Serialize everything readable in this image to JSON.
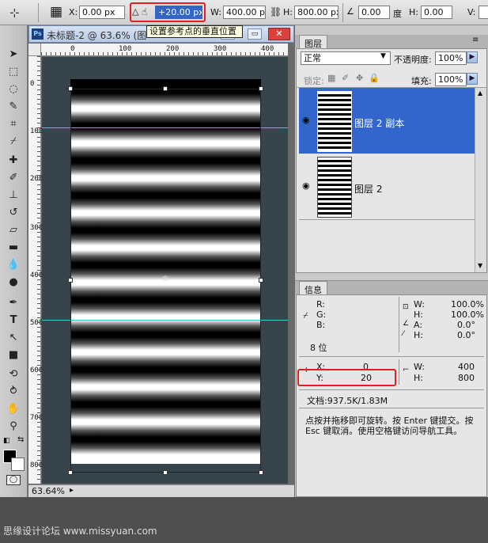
{
  "options": {
    "x_label": "X:",
    "x_value": "0.00 px",
    "y_value": "+20.00 px",
    "w_label": "W:",
    "w_value": "400.00 px",
    "h_label": "H:",
    "h_value": "800.00 px",
    "angle_value": "0.00",
    "angle_unit": "度",
    "hskew_label": "H:",
    "hskew_value": "0.00",
    "vskew_label": "V:",
    "tooltip": "设置参考点的垂直位置"
  },
  "document": {
    "title": "未标题-2 @ 63.6% (图",
    "zoom": "63.64%",
    "ruler_h": [
      "0",
      "100",
      "200",
      "300",
      "400"
    ],
    "ruler_v": [
      "0",
      "100",
      "200",
      "300",
      "400",
      "500",
      "600",
      "700",
      "800"
    ]
  },
  "layers": {
    "tab": "图层",
    "blend_mode": "正常",
    "opacity_label": "不透明度:",
    "opacity_value": "100%",
    "lock_label": "锁定:",
    "fill_label": "填充:",
    "fill_value": "100%",
    "items": [
      {
        "name": "图层 2 副本",
        "selected": true
      },
      {
        "name": "图层 2",
        "selected": false
      }
    ]
  },
  "info": {
    "tab": "信息",
    "r_label": "R:",
    "g_label": "G:",
    "b_label": "B:",
    "bit_depth": "8 位",
    "w1_label": "W:",
    "w1_value": "100.0%",
    "h1_label": "H:",
    "h1_value": "100.0%",
    "a_label": "A:",
    "a_value": "0.0°",
    "h2_label": "H:",
    "h2_value": "0.0°",
    "x_label": "X:",
    "x_value": "0",
    "y_label": "Y:",
    "y_value": "20",
    "w2_label": "W:",
    "w2_value": "400",
    "h3_label": "H:",
    "h3_value": "800",
    "doc_label": "文档:937.5K/1.83M",
    "hint": "点按并拖移即可旋转。按 Enter 键提交。按 Esc 键取消。使用空格键访问导航工具。"
  },
  "watermark": "思缘设计论坛  www.missyuan.com",
  "colors": {
    "accent": "#3366cc",
    "highlight": "#e02020",
    "canvas": "#38444b"
  }
}
